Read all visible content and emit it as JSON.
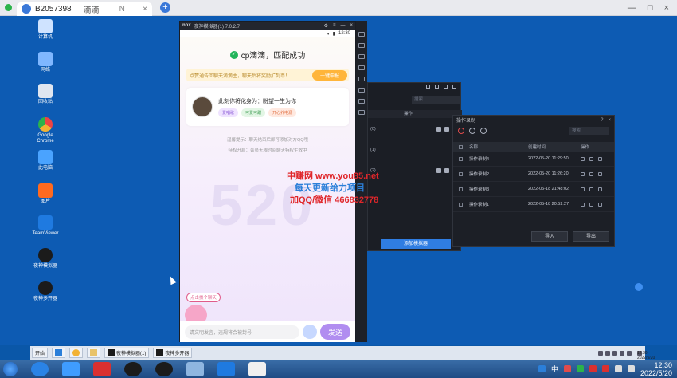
{
  "host_tab": {
    "user_id": "B2057398",
    "app_name": "滴滴",
    "short": "N"
  },
  "desktop_icons": [
    {
      "label": "计算机",
      "color": "#cfe3ff"
    },
    {
      "label": "网络",
      "color": "#7fb7ff"
    },
    {
      "label": "回收站",
      "color": "#dfe6f0"
    },
    {
      "label": "Google Chrome",
      "color": "#f2b233"
    },
    {
      "label": "此电脑",
      "color": "#4aa3ff"
    },
    {
      "label": "图片",
      "color": "#ff6a1f"
    },
    {
      "label": "TeamViewer",
      "color": "#1f7ae0"
    },
    {
      "label": "夜神模拟器",
      "color": "#1b1b1b"
    },
    {
      "label": "夜神多开器",
      "color": "#1b1b1b"
    }
  ],
  "emulator": {
    "title": "夜神模拟器(1) 7.0.2.7",
    "time": "12:30",
    "match_text": "cp滴滴，匹配成功",
    "promo_text": "点赞通告回聊天滴滴主，聊天后将奖励扩列币！",
    "promo_button": "一键申报",
    "card_title": "此刻你将化身为：盼望一生为你",
    "tags": [
      "爱唱歌",
      "可爱可甜",
      "开心养电源"
    ],
    "tip_line1": "温馨提示：聊天结束后即可添加对方QQ哦",
    "tip_line2": "特权开启：会员无限时间聊天特权生效中",
    "bg_number": "520",
    "watermark_line1": "中赚网 www.you85.net",
    "watermark_line2": "每天更新给力项目",
    "watermark_line3": "加QQ/微信 466832778",
    "sticker_label": "点击换个聊天",
    "input_placeholder": "请文明发言，违规将会被封号",
    "send_label": "发送"
  },
  "multi": {
    "search_placeholder": "搜索",
    "col_action": "操作",
    "new_button": "添加模拟器"
  },
  "recorder": {
    "title": "操作录制",
    "search_placeholder": "搜索",
    "headers": {
      "name": "名称",
      "time": "创建时间",
      "action": "操作"
    },
    "rows": [
      {
        "name": "操作录制4",
        "time": "2022-05-20 11:29:50"
      },
      {
        "name": "操作录制2",
        "time": "2022-05-20 11:26:20"
      },
      {
        "name": "操作录制3",
        "time": "2022-05-18 21:48:02"
      },
      {
        "name": "操作录制1",
        "time": "2022-05-18 20:52:27"
      }
    ],
    "import_label": "导入",
    "export_label": "导出"
  },
  "remote_taskbar": {
    "start": "开始",
    "items": [
      "夜神模拟器(1)",
      "夜神多开器"
    ],
    "time": "12:30",
    "date": "2022/5/20"
  },
  "host_taskbar": {
    "ime": "中",
    "time": "12:30",
    "date": "2022/5/20"
  }
}
